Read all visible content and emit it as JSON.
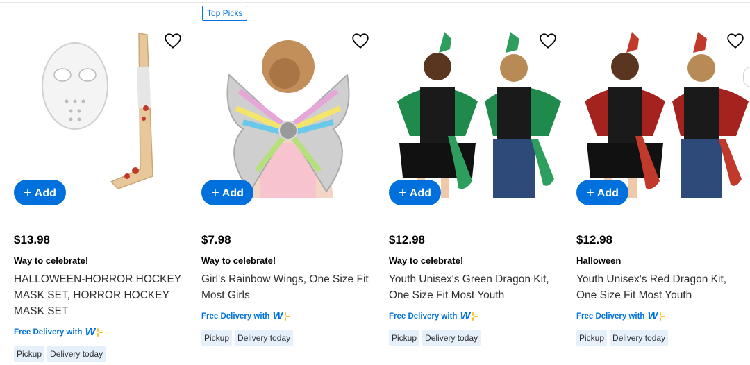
{
  "products": [
    {
      "badge": "",
      "price": "$13.98",
      "kicker": "Way to celebrate!",
      "title": "HALLOWEEN-HORROR HOCKEY MASK SET, HORROR HOCKEY MASK SET",
      "add_label": "Add",
      "delivery_label": "Free Delivery with",
      "chips": [
        "Pickup",
        "Delivery today"
      ]
    },
    {
      "badge": "Top Picks",
      "price": "$7.98",
      "kicker": "Way to celebrate!",
      "title": "Girl's Rainbow Wings, One Size Fit Most Girls",
      "add_label": "Add",
      "delivery_label": "Free Delivery with",
      "chips": [
        "Pickup",
        "Delivery today"
      ]
    },
    {
      "badge": "",
      "price": "$12.98",
      "kicker": "Way to celebrate!",
      "title": "Youth Unisex's Green Dragon Kit, One Size Fit Most Youth",
      "add_label": "Add",
      "delivery_label": "Free Delivery with",
      "chips": [
        "Pickup",
        "Delivery today"
      ]
    },
    {
      "badge": "",
      "price": "$12.98",
      "kicker": "Halloween",
      "title": "Youth Unisex's Red Dragon Kit, One Size Fit Most Youth",
      "add_label": "Add",
      "delivery_label": "Free Delivery with",
      "chips": [
        "Pickup",
        "Delivery today"
      ]
    }
  ],
  "walmart_plus_logo": "W",
  "icons": {
    "favorite": "heart-outline-icon",
    "add": "plus-icon",
    "next": "chevron-right-icon"
  },
  "colors": {
    "accent": "#0071dc",
    "spark": "#ffc220",
    "chip_bg": "#e5f0fb"
  }
}
